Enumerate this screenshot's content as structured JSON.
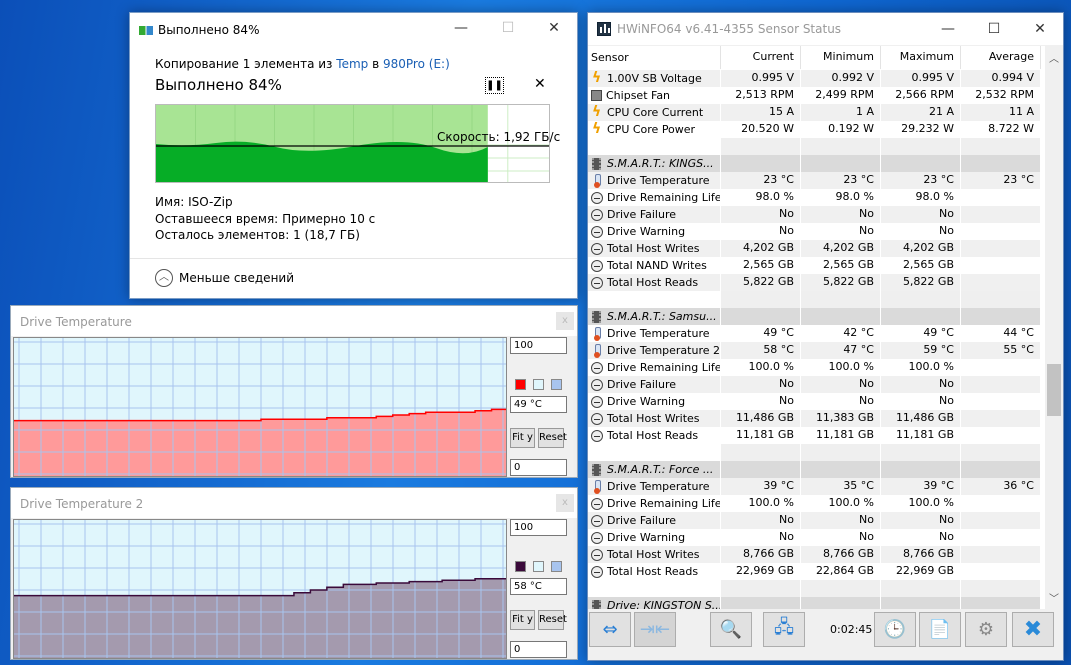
{
  "copy_dialog": {
    "title": "Выполнено 84%",
    "line_prefix": "Копирование 1 элемента из",
    "source": "Temp",
    "line_mid": "в",
    "dest": "980Pro (E:)",
    "heading": "Выполнено 84%",
    "progress_percent": 84,
    "speed": "Скорость: 1,92 ГБ/с",
    "name_label": "Имя:",
    "name_value": "ISO-Zip",
    "time_label": "Оставшееся время:",
    "time_value": "Примерно 10 с",
    "items_label": "Осталось элементов:",
    "items_value": "1 (18,7 ГБ)",
    "less_details": "Меньше сведений",
    "pause_glyph": "❚❚",
    "cancel_glyph": "✕"
  },
  "graphs": [
    {
      "title": "Drive Temperature",
      "max": "100",
      "current": "49 °C",
      "min": "0",
      "fit": "Fit y",
      "reset": "Reset",
      "line_color": "#ff0000",
      "fill_color": "#ff9a9a",
      "bg_color": "#e0f6fc",
      "grid_color": "#a8c4ee"
    },
    {
      "title": "Drive Temperature 2",
      "max": "100",
      "current": "58 °C",
      "min": "0",
      "fit": "Fit y",
      "reset": "Reset",
      "line_color": "#3a0a3a",
      "fill_color": "#a49aae",
      "bg_color": "#e0f6fc",
      "grid_color": "#a8c4ee"
    }
  ],
  "chart_data": [
    {
      "type": "area",
      "title": "Drive Temperature",
      "ylim": [
        0,
        100
      ],
      "grid": true,
      "values": [
        41,
        41,
        41,
        41,
        41,
        41,
        41,
        41,
        41,
        41,
        41,
        41,
        41,
        41,
        41,
        42,
        42,
        42,
        42,
        43,
        43,
        43,
        44,
        45,
        46,
        47,
        47,
        47,
        48,
        49
      ]
    },
    {
      "type": "area",
      "title": "Drive Temperature 2",
      "ylim": [
        0,
        100
      ],
      "grid": true,
      "values": [
        46,
        46,
        46,
        46,
        46,
        46,
        46,
        46,
        46,
        46,
        46,
        46,
        46,
        46,
        46,
        46,
        46,
        48,
        50,
        52,
        54,
        54,
        55,
        55,
        56,
        56,
        57,
        57,
        58,
        58
      ]
    }
  ],
  "hwinfo": {
    "title": "HWiNFO64 v6.41-4355 Sensor Status",
    "columns": [
      "Sensor",
      "Current",
      "Minimum",
      "Maximum",
      "Average"
    ],
    "rows": [
      {
        "icon": "bolt",
        "cells": [
          "1.00V SB Voltage",
          "0.995 V",
          "0.992 V",
          "0.995 V",
          "0.994 V"
        ]
      },
      {
        "icon": "fan",
        "cells": [
          "Chipset Fan",
          "2,513 RPM",
          "2,499 RPM",
          "2,566 RPM",
          "2,532 RPM"
        ]
      },
      {
        "icon": "bolt",
        "cells": [
          "CPU Core Current",
          "15 A",
          "1 A",
          "21 A",
          "11 A"
        ]
      },
      {
        "icon": "bolt",
        "cells": [
          "CPU Core Power",
          "20.520 W",
          "0.192 W",
          "29.232 W",
          "8.722 W"
        ]
      },
      {
        "kind": "blank"
      },
      {
        "kind": "sec",
        "icon": "chip",
        "cells": [
          "S.M.A.R.T.: KINGS..."
        ]
      },
      {
        "icon": "therm",
        "cells": [
          "Drive Temperature",
          "23 °C",
          "23 °C",
          "23 °C",
          "23 °C"
        ]
      },
      {
        "icon": "gauge",
        "cells": [
          "Drive Remaining Life",
          "98.0 %",
          "98.0 %",
          "98.0 %",
          ""
        ]
      },
      {
        "icon": "gauge",
        "cells": [
          "Drive Failure",
          "No",
          "No",
          "No",
          ""
        ]
      },
      {
        "icon": "gauge",
        "cells": [
          "Drive Warning",
          "No",
          "No",
          "No",
          ""
        ]
      },
      {
        "icon": "gauge",
        "cells": [
          "Total Host Writes",
          "4,202 GB",
          "4,202 GB",
          "4,202 GB",
          ""
        ]
      },
      {
        "icon": "gauge",
        "cells": [
          "Total NAND Writes",
          "2,565 GB",
          "2,565 GB",
          "2,565 GB",
          ""
        ]
      },
      {
        "icon": "gauge",
        "cells": [
          "Total Host Reads",
          "5,822 GB",
          "5,822 GB",
          "5,822 GB",
          ""
        ]
      },
      {
        "kind": "blank"
      },
      {
        "kind": "sec",
        "icon": "chip",
        "cells": [
          "S.M.A.R.T.: Samsu..."
        ]
      },
      {
        "icon": "therm",
        "cells": [
          "Drive Temperature",
          "49 °C",
          "42 °C",
          "49 °C",
          "44 °C"
        ]
      },
      {
        "icon": "therm",
        "cells": [
          "Drive Temperature 2",
          "58 °C",
          "47 °C",
          "59 °C",
          "55 °C"
        ]
      },
      {
        "icon": "gauge",
        "cells": [
          "Drive Remaining Life",
          "100.0 %",
          "100.0 %",
          "100.0 %",
          ""
        ]
      },
      {
        "icon": "gauge",
        "cells": [
          "Drive Failure",
          "No",
          "No",
          "No",
          ""
        ]
      },
      {
        "icon": "gauge",
        "cells": [
          "Drive Warning",
          "No",
          "No",
          "No",
          ""
        ]
      },
      {
        "icon": "gauge",
        "cells": [
          "Total Host Writes",
          "11,486 GB",
          "11,383 GB",
          "11,486 GB",
          ""
        ]
      },
      {
        "icon": "gauge",
        "cells": [
          "Total Host Reads",
          "11,181 GB",
          "11,181 GB",
          "11,181 GB",
          ""
        ]
      },
      {
        "kind": "blank"
      },
      {
        "kind": "sec",
        "icon": "chip",
        "cells": [
          "S.M.A.R.T.: Force ..."
        ]
      },
      {
        "icon": "therm",
        "cells": [
          "Drive Temperature",
          "39 °C",
          "35 °C",
          "39 °C",
          "36 °C"
        ]
      },
      {
        "icon": "gauge",
        "cells": [
          "Drive Remaining Life",
          "100.0 %",
          "100.0 %",
          "100.0 %",
          ""
        ]
      },
      {
        "icon": "gauge",
        "cells": [
          "Drive Failure",
          "No",
          "No",
          "No",
          ""
        ]
      },
      {
        "icon": "gauge",
        "cells": [
          "Drive Warning",
          "No",
          "No",
          "No",
          ""
        ]
      },
      {
        "icon": "gauge",
        "cells": [
          "Total Host Writes",
          "8,766 GB",
          "8,766 GB",
          "8,766 GB",
          ""
        ]
      },
      {
        "icon": "gauge",
        "cells": [
          "Total Host Reads",
          "22,969 GB",
          "22,864 GB",
          "22,969 GB",
          ""
        ]
      },
      {
        "kind": "blank"
      },
      {
        "kind": "sec",
        "icon": "chip",
        "cells": [
          "Drive: KINGSTON S..."
        ]
      }
    ],
    "timer": "0:02:45"
  }
}
